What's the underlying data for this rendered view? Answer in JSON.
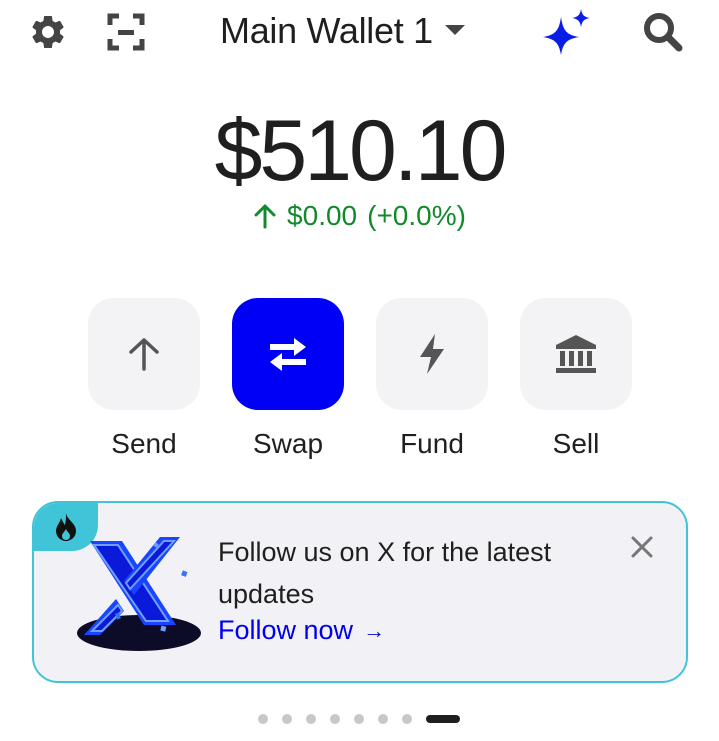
{
  "header": {
    "wallet_name": "Main Wallet 1",
    "settings_icon": "gear-icon",
    "scan_icon": "scan-icon",
    "assistant_icon": "sparkle-icon",
    "search_icon": "search-icon",
    "dropdown_icon": "caret-down-icon"
  },
  "balance": {
    "amount": "$510.10",
    "change_amount": "$0.00",
    "change_percent": "(+0.0%)",
    "change_icon": "arrow-up-icon"
  },
  "actions": [
    {
      "label": "Send",
      "icon": "arrow-up-icon"
    },
    {
      "label": "Swap",
      "icon": "swap-arrows-icon"
    },
    {
      "label": "Fund",
      "icon": "lightning-icon"
    },
    {
      "label": "Sell",
      "icon": "bank-icon"
    }
  ],
  "promo": {
    "text": "Follow us on X for the latest updates",
    "link_label": "Follow now",
    "link_arrow": "→",
    "badge_icon": "flame-icon",
    "close_icon": "close-icon"
  },
  "pagination": {
    "count": 8,
    "active_index": 7
  },
  "colors": {
    "accent": "#0000f6",
    "positive": "#118a2c",
    "promo_border": "#40c4d8",
    "link": "#0000ee"
  }
}
